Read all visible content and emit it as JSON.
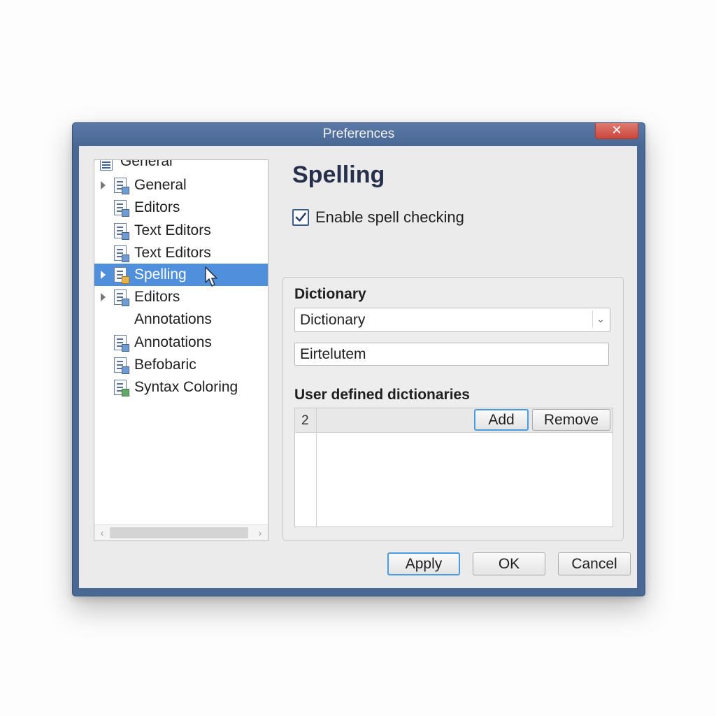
{
  "window": {
    "title": "Preferences",
    "close_glyph": "✕"
  },
  "tree": {
    "partial_item": "General",
    "items": [
      {
        "label": "General",
        "expandable": true,
        "icon": "document-icon"
      },
      {
        "label": "Editors",
        "expandable": false,
        "icon": "document-icon"
      },
      {
        "label": "Text Editors",
        "expandable": false,
        "icon": "document-icon"
      },
      {
        "label": "Text Editors",
        "expandable": false,
        "icon": "document-icon"
      },
      {
        "label": "Spelling",
        "expandable": true,
        "selected": true,
        "icon": "document-icon"
      },
      {
        "label": "Editors",
        "expandable": true,
        "icon": "document-icon"
      },
      {
        "label": "Annotations",
        "expandable": false,
        "icon": "none"
      },
      {
        "label": "Annotations",
        "expandable": false,
        "icon": "document-icon"
      },
      {
        "label": "Befobaric",
        "expandable": false,
        "icon": "document-icon"
      },
      {
        "label": "Syntax Coloring",
        "expandable": false,
        "icon": "document-icon"
      }
    ],
    "scroll_left": "‹",
    "scroll_right": "›"
  },
  "page": {
    "title": "Spelling",
    "enable_spell_checking": {
      "label": "Enable spell checking",
      "checked": true
    },
    "dictionary": {
      "label": "Dictionary",
      "selected": "Dictionary",
      "text_value": "Eirtelutem"
    },
    "user_dictionaries": {
      "label": "User defined dictionaries",
      "row_number": "2",
      "add_label": "Add",
      "remove_label": "Remove"
    }
  },
  "footer": {
    "apply_label": "Apply",
    "ok_label": "OK",
    "cancel_label": "Cancel"
  },
  "colors": {
    "titlebar": "#4a6894",
    "selection": "#4f8fdc",
    "close": "#c9473c",
    "focus": "#4a9be0"
  }
}
